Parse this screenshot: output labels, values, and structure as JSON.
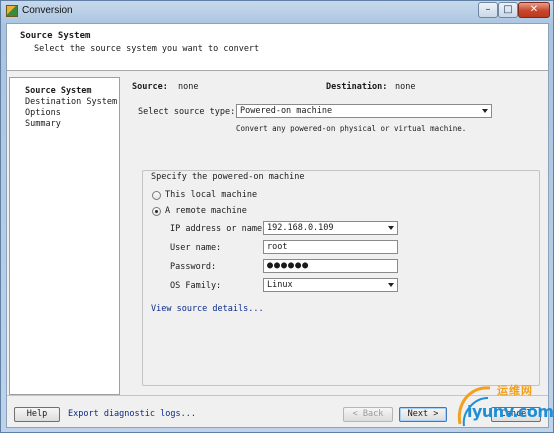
{
  "window": {
    "title": "Conversion",
    "controls": {
      "minimize": "–",
      "maximize": "□",
      "close": "✕"
    }
  },
  "header": {
    "title": "Source System",
    "subtitle": "Select the source system you want to convert"
  },
  "sidebar": {
    "items": [
      {
        "label": "Source System",
        "active": true
      },
      {
        "label": "Destination System",
        "active": false
      },
      {
        "label": "Options",
        "active": false
      },
      {
        "label": "Summary",
        "active": false
      }
    ]
  },
  "summary": {
    "source_label": "Source:",
    "source_value": "none",
    "destination_label": "Destination:",
    "destination_value": "none"
  },
  "source_type": {
    "label": "Select source type:",
    "value": "Powered-on machine",
    "hint": "Convert any powered-on physical or virtual machine."
  },
  "powered_on": {
    "group_title": "Specify the powered-on machine",
    "option_local": "This local machine",
    "option_remote": "A remote machine",
    "selected": "remote",
    "ip_label": "IP address or name:",
    "ip_value": "192.168.0.109",
    "user_label": "User name:",
    "user_value": "root",
    "password_label": "Password:",
    "password_value": "●●●●●●",
    "os_label": "OS Family:",
    "os_value": "Linux",
    "details_link": "View source details..."
  },
  "footer": {
    "help": "Help",
    "export_link": "Export diagnostic logs...",
    "back": "< Back",
    "next": "Next >",
    "cancel": "Cancel"
  },
  "watermark": {
    "text_cn": "运维网",
    "text_en": "iyunv.com"
  },
  "colors": {
    "link": "#0b2a8a",
    "accent": "#3a7bbf",
    "titlebar": "#aac4e0"
  },
  "icons": {
    "app": "conversion-app-icon",
    "dropdown": "chevron-down-icon"
  }
}
